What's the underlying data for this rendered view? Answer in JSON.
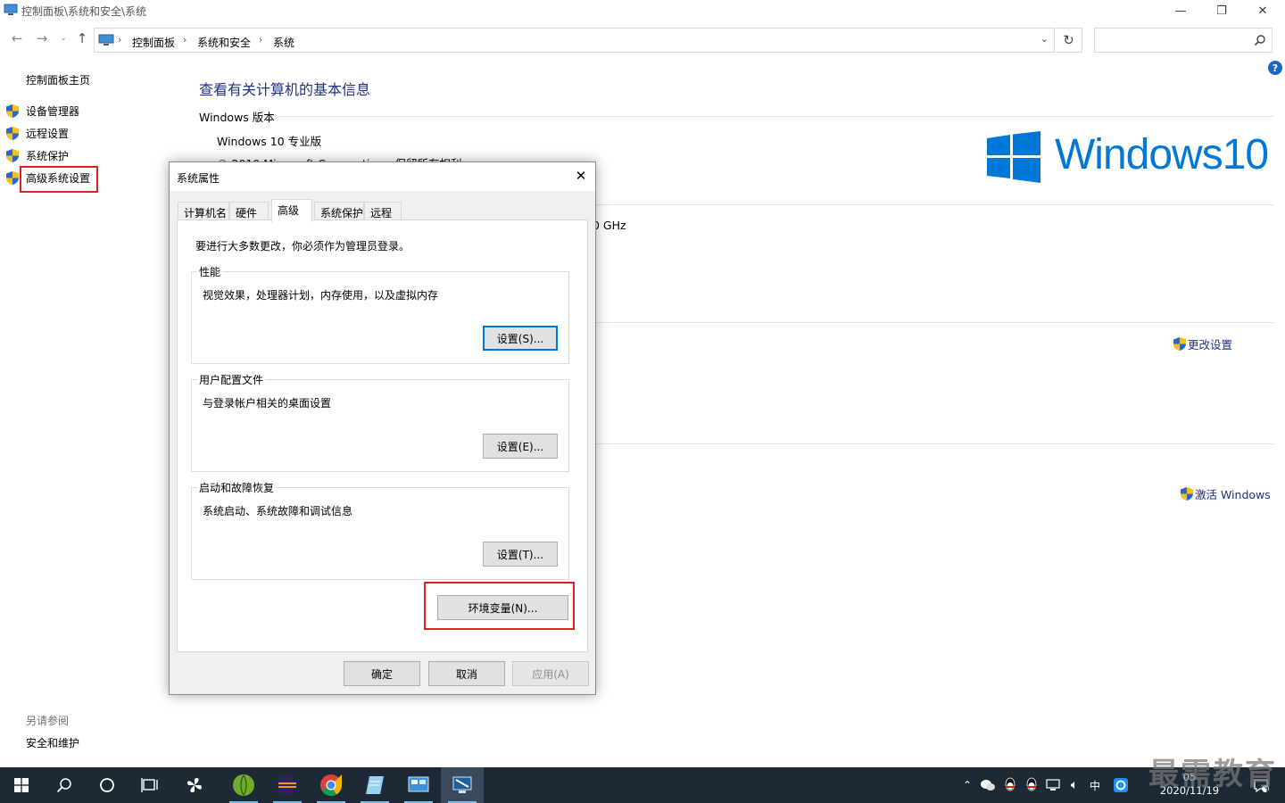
{
  "window": {
    "title": "控制面板\\系统和安全\\系统",
    "minimize": "—",
    "restore": "❐",
    "close": "✕"
  },
  "address": {
    "crumbs": [
      "控制面板",
      "系统和安全",
      "系统"
    ],
    "separator": "›",
    "search_placeholder": ""
  },
  "leftpane": {
    "home": "控制面板主页",
    "items": [
      {
        "label": "设备管理器"
      },
      {
        "label": "远程设置"
      },
      {
        "label": "系统保护"
      },
      {
        "label": "高级系统设置"
      }
    ],
    "see_also": "另请参阅",
    "see_also_items": [
      "安全和维护"
    ]
  },
  "main": {
    "title": "查看有关计算机的基本信息",
    "edition_section": "Windows 版本",
    "edition": "Windows 10 专业版",
    "copyright": "© 2019 Microsoft Corporation。保留所有权利。",
    "cpu_fragment": "0 GHz",
    "change_settings": "更改设置",
    "activate": "激活 Windows",
    "win10_logo_text": "Windows10"
  },
  "dialog": {
    "title": "系统属性",
    "tabs": [
      "计算机名",
      "硬件",
      "高级",
      "系统保护",
      "远程"
    ],
    "active_tab": "高级",
    "note": "要进行大多数更改，你必须作为管理员登录。",
    "groups": [
      {
        "title": "性能",
        "desc": "视觉效果，处理器计划，内存使用，以及虚拟内存",
        "button": "设置(S)..."
      },
      {
        "title": "用户配置文件",
        "desc": "与登录帐户相关的桌面设置",
        "button": "设置(E)..."
      },
      {
        "title": "启动和故障恢复",
        "desc": "系统启动、系统故障和调试信息",
        "button": "设置(T)..."
      }
    ],
    "env_button": "环境变量(N)...",
    "ok": "确定",
    "cancel": "取消",
    "apply": "应用(A)"
  },
  "taskbar": {
    "tray_ime": "中",
    "clock_time": "05",
    "clock_date": "2020/11/19",
    "notification_count": "1",
    "watermark": "最需教育"
  },
  "colors": {
    "link": "#1e3287",
    "accent": "#0078d7",
    "highlight": "#e02020",
    "taskbar": "#1d2a36"
  }
}
